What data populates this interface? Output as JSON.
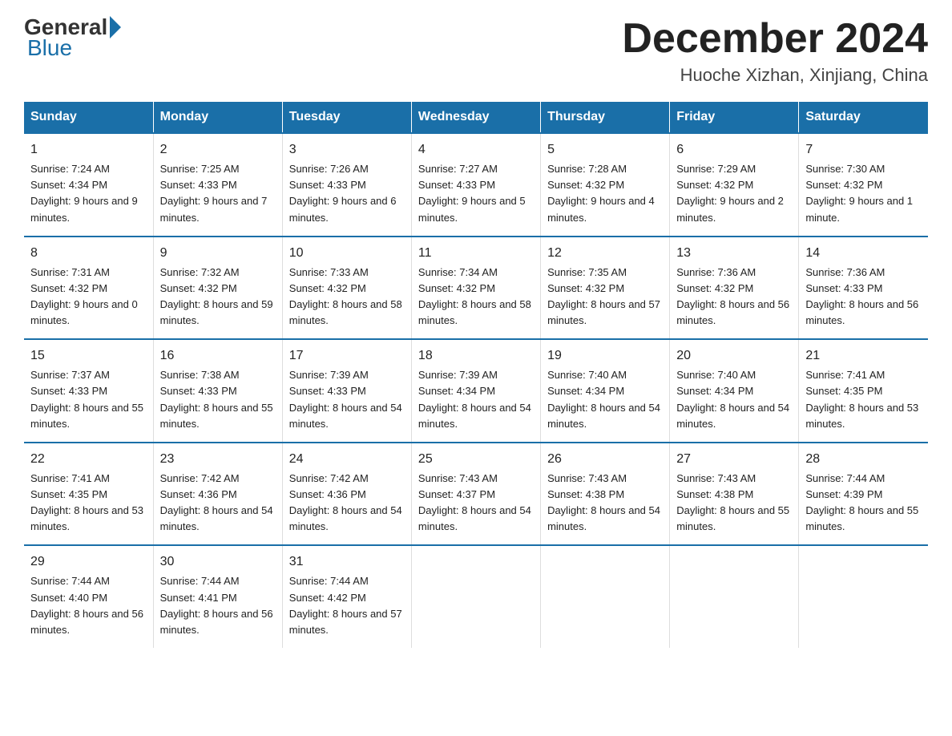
{
  "header": {
    "logo_general": "General",
    "logo_blue": "Blue",
    "title": "December 2024",
    "subtitle": "Huoche Xizhan, Xinjiang, China"
  },
  "days_of_week": [
    "Sunday",
    "Monday",
    "Tuesday",
    "Wednesday",
    "Thursday",
    "Friday",
    "Saturday"
  ],
  "weeks": [
    [
      {
        "day": "1",
        "sunrise": "7:24 AM",
        "sunset": "4:34 PM",
        "daylight": "9 hours and 9 minutes."
      },
      {
        "day": "2",
        "sunrise": "7:25 AM",
        "sunset": "4:33 PM",
        "daylight": "9 hours and 7 minutes."
      },
      {
        "day": "3",
        "sunrise": "7:26 AM",
        "sunset": "4:33 PM",
        "daylight": "9 hours and 6 minutes."
      },
      {
        "day": "4",
        "sunrise": "7:27 AM",
        "sunset": "4:33 PM",
        "daylight": "9 hours and 5 minutes."
      },
      {
        "day": "5",
        "sunrise": "7:28 AM",
        "sunset": "4:32 PM",
        "daylight": "9 hours and 4 minutes."
      },
      {
        "day": "6",
        "sunrise": "7:29 AM",
        "sunset": "4:32 PM",
        "daylight": "9 hours and 2 minutes."
      },
      {
        "day": "7",
        "sunrise": "7:30 AM",
        "sunset": "4:32 PM",
        "daylight": "9 hours and 1 minute."
      }
    ],
    [
      {
        "day": "8",
        "sunrise": "7:31 AM",
        "sunset": "4:32 PM",
        "daylight": "9 hours and 0 minutes."
      },
      {
        "day": "9",
        "sunrise": "7:32 AM",
        "sunset": "4:32 PM",
        "daylight": "8 hours and 59 minutes."
      },
      {
        "day": "10",
        "sunrise": "7:33 AM",
        "sunset": "4:32 PM",
        "daylight": "8 hours and 58 minutes."
      },
      {
        "day": "11",
        "sunrise": "7:34 AM",
        "sunset": "4:32 PM",
        "daylight": "8 hours and 58 minutes."
      },
      {
        "day": "12",
        "sunrise": "7:35 AM",
        "sunset": "4:32 PM",
        "daylight": "8 hours and 57 minutes."
      },
      {
        "day": "13",
        "sunrise": "7:36 AM",
        "sunset": "4:32 PM",
        "daylight": "8 hours and 56 minutes."
      },
      {
        "day": "14",
        "sunrise": "7:36 AM",
        "sunset": "4:33 PM",
        "daylight": "8 hours and 56 minutes."
      }
    ],
    [
      {
        "day": "15",
        "sunrise": "7:37 AM",
        "sunset": "4:33 PM",
        "daylight": "8 hours and 55 minutes."
      },
      {
        "day": "16",
        "sunrise": "7:38 AM",
        "sunset": "4:33 PM",
        "daylight": "8 hours and 55 minutes."
      },
      {
        "day": "17",
        "sunrise": "7:39 AM",
        "sunset": "4:33 PM",
        "daylight": "8 hours and 54 minutes."
      },
      {
        "day": "18",
        "sunrise": "7:39 AM",
        "sunset": "4:34 PM",
        "daylight": "8 hours and 54 minutes."
      },
      {
        "day": "19",
        "sunrise": "7:40 AM",
        "sunset": "4:34 PM",
        "daylight": "8 hours and 54 minutes."
      },
      {
        "day": "20",
        "sunrise": "7:40 AM",
        "sunset": "4:34 PM",
        "daylight": "8 hours and 54 minutes."
      },
      {
        "day": "21",
        "sunrise": "7:41 AM",
        "sunset": "4:35 PM",
        "daylight": "8 hours and 53 minutes."
      }
    ],
    [
      {
        "day": "22",
        "sunrise": "7:41 AM",
        "sunset": "4:35 PM",
        "daylight": "8 hours and 53 minutes."
      },
      {
        "day": "23",
        "sunrise": "7:42 AM",
        "sunset": "4:36 PM",
        "daylight": "8 hours and 54 minutes."
      },
      {
        "day": "24",
        "sunrise": "7:42 AM",
        "sunset": "4:36 PM",
        "daylight": "8 hours and 54 minutes."
      },
      {
        "day": "25",
        "sunrise": "7:43 AM",
        "sunset": "4:37 PM",
        "daylight": "8 hours and 54 minutes."
      },
      {
        "day": "26",
        "sunrise": "7:43 AM",
        "sunset": "4:38 PM",
        "daylight": "8 hours and 54 minutes."
      },
      {
        "day": "27",
        "sunrise": "7:43 AM",
        "sunset": "4:38 PM",
        "daylight": "8 hours and 55 minutes."
      },
      {
        "day": "28",
        "sunrise": "7:44 AM",
        "sunset": "4:39 PM",
        "daylight": "8 hours and 55 minutes."
      }
    ],
    [
      {
        "day": "29",
        "sunrise": "7:44 AM",
        "sunset": "4:40 PM",
        "daylight": "8 hours and 56 minutes."
      },
      {
        "day": "30",
        "sunrise": "7:44 AM",
        "sunset": "4:41 PM",
        "daylight": "8 hours and 56 minutes."
      },
      {
        "day": "31",
        "sunrise": "7:44 AM",
        "sunset": "4:42 PM",
        "daylight": "8 hours and 57 minutes."
      },
      null,
      null,
      null,
      null
    ]
  ],
  "labels": {
    "sunrise": "Sunrise:",
    "sunset": "Sunset:",
    "daylight": "Daylight:"
  }
}
